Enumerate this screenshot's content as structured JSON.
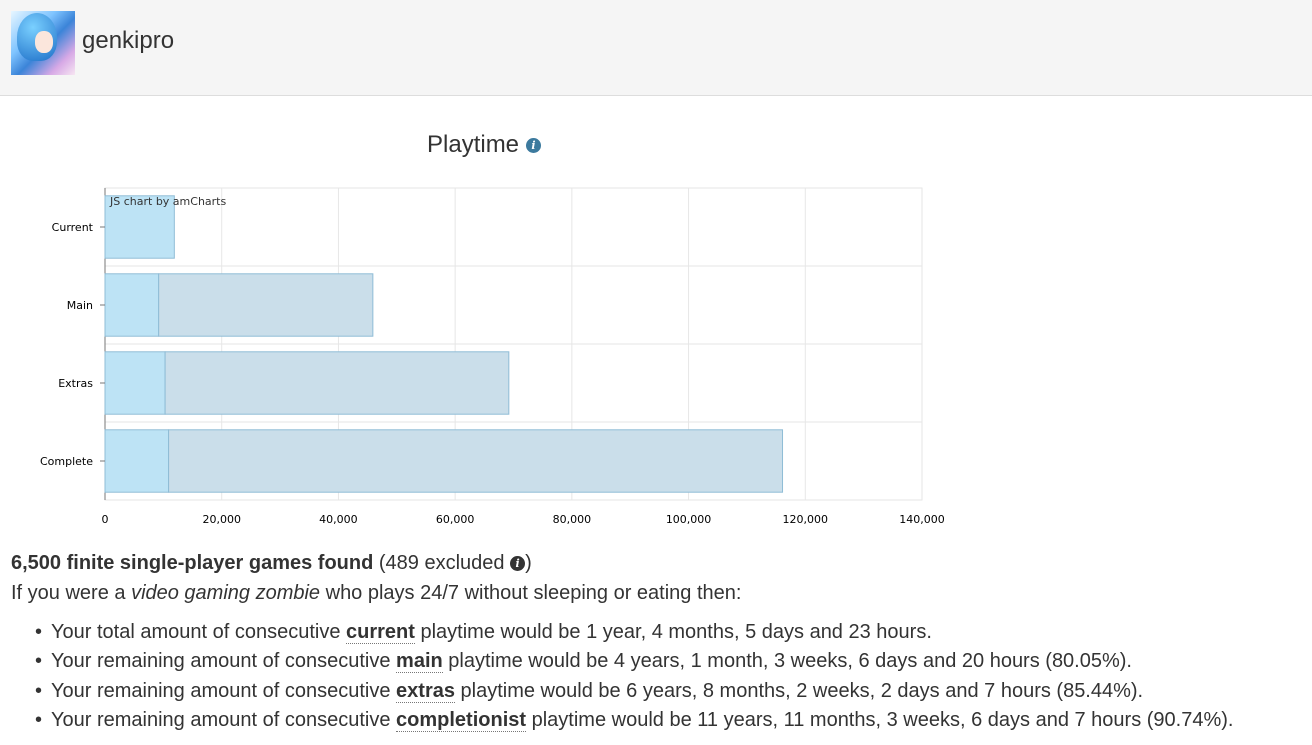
{
  "header": {
    "username": "genkipro"
  },
  "chart_title": "Playtime",
  "chart_watermark": "JS chart by amCharts",
  "chart_data": {
    "type": "bar",
    "orientation": "horizontal",
    "categories": [
      "Current",
      "Main",
      "Extras",
      "Complete"
    ],
    "series": [
      {
        "values": [
          11880,
          9200,
          10300,
          10900
        ],
        "color": "#bde3f5"
      },
      {
        "values": [
          0,
          36700,
          58900,
          105200
        ],
        "color": "#cadeea"
      }
    ],
    "xlim": [
      0,
      140000
    ],
    "x_ticks": [
      0,
      20000,
      40000,
      60000,
      80000,
      100000,
      120000,
      140000
    ],
    "x_tick_labels": [
      "0",
      "20,000",
      "40,000",
      "60,000",
      "80,000",
      "100,000",
      "120,000",
      "140,000"
    ],
    "grid": true,
    "stacked": true
  },
  "summary": {
    "found": "6,500 finite single-player games found",
    "excluded": "(489 excluded",
    "excluded_close": ")",
    "intro_prefix": "If you were a ",
    "intro_em": "video gaming zombie",
    "intro_suffix": " who plays 24/7 without sleeping or eating then:"
  },
  "lines": [
    {
      "prefix": "Your total amount of consecutive ",
      "keyword": "current",
      "suffix": " playtime would be 1 year, 4 months, 5 days and 23 hours."
    },
    {
      "prefix": "Your remaining amount of consecutive ",
      "keyword": "main",
      "suffix": " playtime would be 4 years, 1 month, 3 weeks, 6 days and 20 hours (80.05%)."
    },
    {
      "prefix": "Your remaining amount of consecutive ",
      "keyword": "extras",
      "suffix": " playtime would be 6 years, 8 months, 2 weeks, 2 days and 7 hours (85.44%)."
    },
    {
      "prefix": "Your remaining amount of consecutive ",
      "keyword": "completionist",
      "suffix": " playtime would be 11 years, 11 months, 3 weeks, 6 days and 7 hours (90.74%)."
    }
  ]
}
